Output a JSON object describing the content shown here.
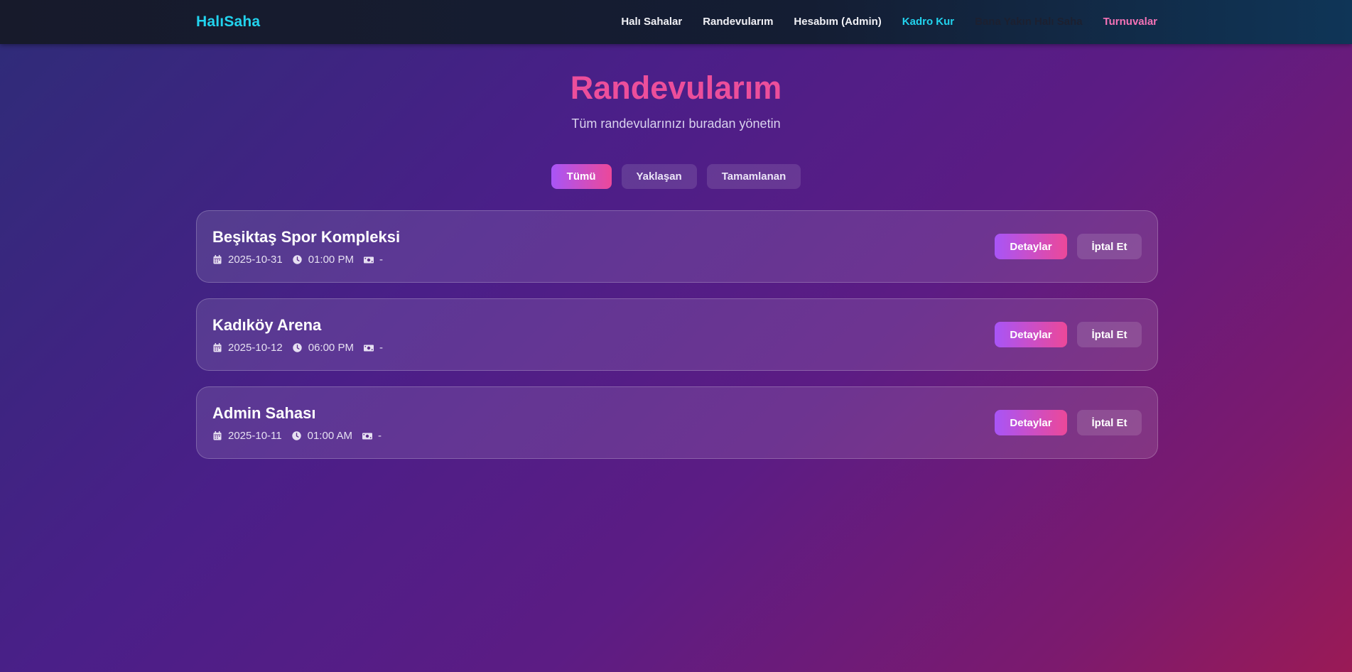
{
  "brand": "HalıSaha",
  "nav": {
    "items": [
      {
        "label": "Halı Sahalar"
      },
      {
        "label": "Randevularım"
      },
      {
        "label": "Hesabım (Admin)"
      },
      {
        "label": "Kadro Kur"
      },
      {
        "label": "Bana Yakın Halı Saha"
      },
      {
        "label": "Turnuvalar"
      }
    ]
  },
  "header": {
    "title": "Randevularım",
    "subtitle": "Tüm randevularınızı buradan yönetin"
  },
  "filters": {
    "all": "Tümü",
    "upcoming": "Yaklaşan",
    "completed": "Tamamlanan"
  },
  "appointments": [
    {
      "name": "Beşiktaş Spor Kompleksi",
      "date": "2025-10-31",
      "time": "01:00 PM",
      "price": "-"
    },
    {
      "name": "Kadıköy Arena",
      "date": "2025-10-12",
      "time": "06:00 PM",
      "price": "-"
    },
    {
      "name": "Admin Sahası",
      "date": "2025-10-11",
      "time": "01:00 AM",
      "price": "-"
    }
  ],
  "actions": {
    "details": "Detaylar",
    "cancel": "İptal Et"
  },
  "colors": {
    "brand": "#22d3ee",
    "title": "#ec4e9b",
    "accent_gradient_start": "#a855f7",
    "accent_gradient_end": "#ec4899",
    "nav_highlight_cyan": "#22d3ee",
    "nav_highlight_pink": "#f472b6"
  }
}
